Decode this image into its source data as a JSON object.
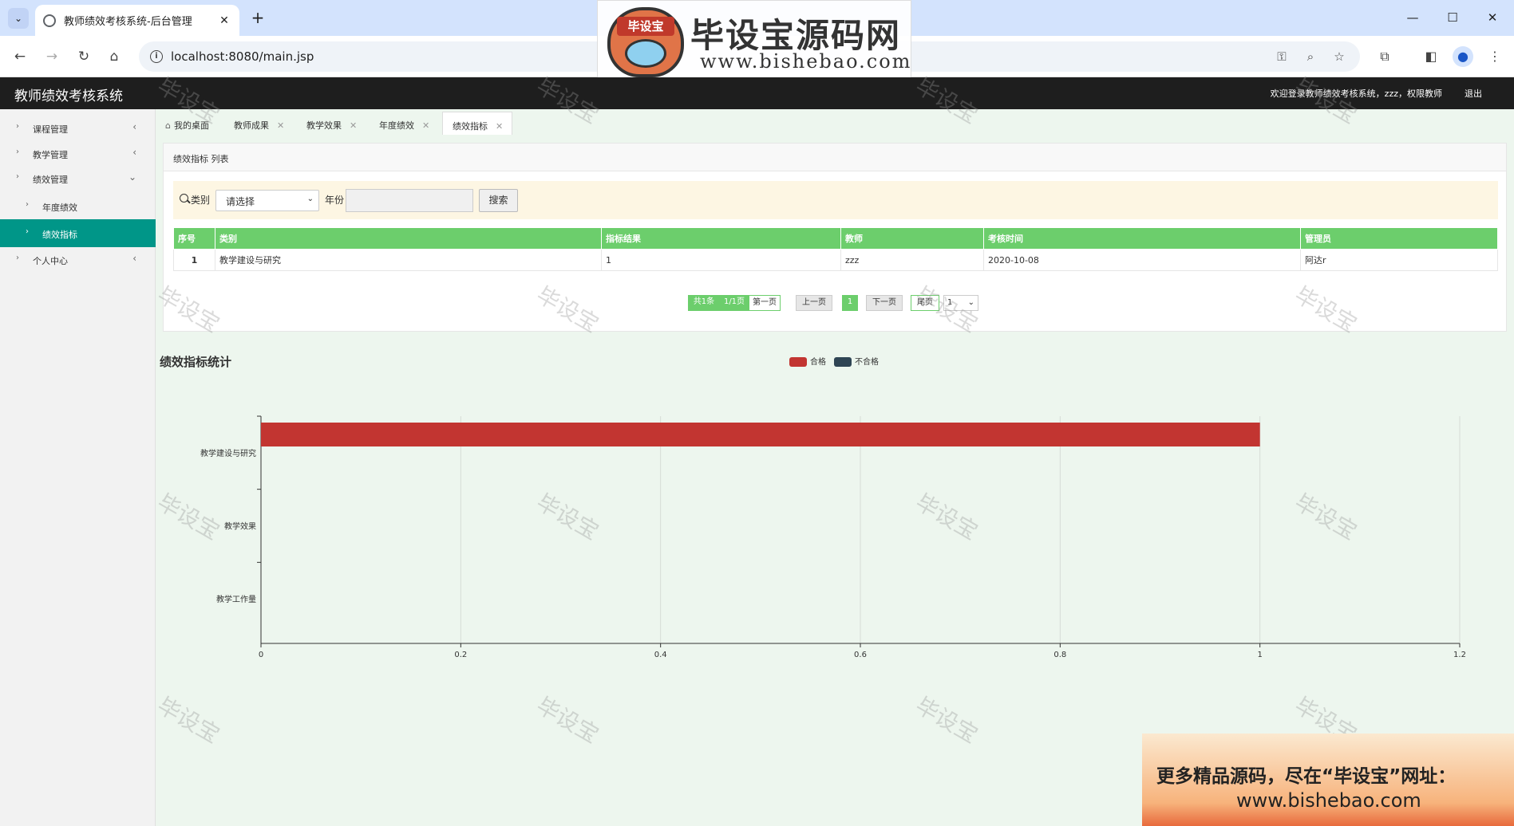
{
  "browser": {
    "tab_title": "教师绩效考核系统-后台管理",
    "url": "localhost:8080/main.jsp"
  },
  "logo": {
    "badge": "毕设宝",
    "brand": "毕设宝源码网",
    "site": "www.bishebao.com"
  },
  "app": {
    "title": "教师绩效考核系统",
    "welcome": "欢迎登录教师绩效考核系统，zzz，权限教师",
    "logout": "退出"
  },
  "sidebar": {
    "items": [
      {
        "label": "课程管理"
      },
      {
        "label": "教学管理"
      },
      {
        "label": "绩效管理"
      },
      {
        "label": "年度绩效"
      },
      {
        "label": "绩效指标"
      },
      {
        "label": "个人中心"
      }
    ]
  },
  "tabs": [
    "我的桌面",
    "教师成果",
    "教学效果",
    "年度绩效",
    "绩效指标"
  ],
  "panel": {
    "title": "绩效指标 列表",
    "type_label": "类别",
    "type_select": "请选择",
    "year_label": "年份",
    "search_button": "搜索"
  },
  "table": {
    "headers": [
      "序号",
      "类别",
      "指标结果",
      "教师",
      "考核时间",
      "管理员"
    ],
    "rows": [
      [
        "1",
        "教学建设与研究",
        "1",
        "zzz",
        "2020-10-08",
        "阿达r"
      ]
    ]
  },
  "pager": {
    "total": "共1条",
    "pages": "1/1页",
    "first": "第一页",
    "prev": "上一页",
    "current": "1",
    "next": "下一页",
    "last": "尾页",
    "select": "1"
  },
  "chart_data": {
    "type": "bar",
    "orientation": "horizontal",
    "title": "绩效指标统计",
    "categories": [
      "教学建设与研究",
      "教学效果",
      "教学工作量"
    ],
    "series": [
      {
        "name": "合格",
        "color": "#c23531",
        "values": [
          1,
          0,
          0
        ]
      },
      {
        "name": "不合格",
        "color": "#2f4554",
        "values": [
          0,
          0,
          0
        ]
      }
    ],
    "xlim": [
      0,
      1.2
    ],
    "xticks": [
      "0",
      "0.2",
      "0.4",
      "0.6",
      "0.8",
      "1",
      "1.2"
    ],
    "grid": true,
    "legend": "top-center"
  },
  "watermark": "毕设宝",
  "promo": {
    "line1": "更多精品源码，尽在“毕设宝”网址：",
    "line2": "www.bishebao.com"
  }
}
